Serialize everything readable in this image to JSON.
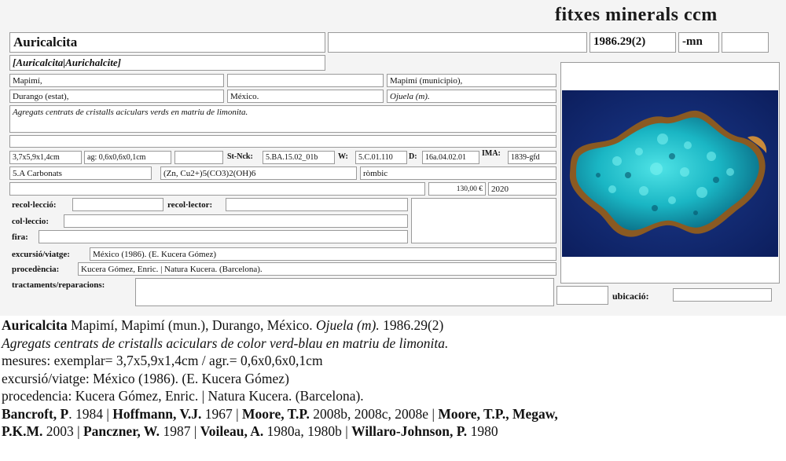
{
  "header": {
    "site_title": "fitxes minerals ccm"
  },
  "card": {
    "mineral_name": "Auricalcita",
    "blank_top_field": "",
    "catalog_number": "1986.29(2)",
    "suffix": "-mn",
    "suffix_extra": "",
    "synonyms": "[Auricalcita|Aurichalcite]",
    "locality": {
      "place": "Mapimí,",
      "place_extra": "",
      "municipality": "Mapimí (municipio),",
      "state": "Durango (estat),",
      "country": "México.",
      "mine": "Ojuela (m)."
    },
    "description": "Agregats centrats de cristalls aciculars verds en matriu de limonita.",
    "blank_line": "",
    "measures": {
      "specimen": "3,7x5,9x1,4cm",
      "aggregate": "ag: 0,6x0,6x0,1cm",
      "extra": ""
    },
    "codes": {
      "strunz_label": "St-Nck:",
      "strunz_value": "5.BA.15.02_01b",
      "w_label": "W:",
      "w_value": "5.C.01.110",
      "d_label": "D:",
      "d_value": "16a.04.02.01",
      "ima_label": "IMA:",
      "ima_value": "1839-gfd"
    },
    "classification": {
      "class": "5.A Carbonats",
      "formula": "(Zn, Cu2+)5(CO3)2(OH)6",
      "crystal_system": "ròmbic"
    },
    "price_row": {
      "note": "",
      "price": "130,00 €",
      "year": "2020"
    },
    "labels": {
      "recollection": "recol·lecció:",
      "collector": "recol·lector:",
      "collection": "col·leccio:",
      "fair": "fira:",
      "trip": "excursió/viatge:",
      "origin": "procedència:",
      "treatments": "tractaments/reparacions:",
      "location": "ubicació:"
    },
    "values": {
      "recollection": "",
      "collector": "",
      "collection": "",
      "fair": "",
      "side_box": "",
      "trip": "México (1986). (E. Kucera Gómez)",
      "origin": "Kucera Gómez, Enric. | Natura Kucera. (Barcelona).",
      "treatments": "",
      "location_pre": "",
      "location": ""
    },
    "photo_icon": "mineral-photo-icon"
  },
  "caption": {
    "line1_name": "Auricalcita",
    "line1_locality": " Mapimí, Mapimí (mun.), Durango, México. ",
    "line1_mine": "Ojuela (m).",
    "line1_number": " 1986.29(2)",
    "line2": "Agregats centrats de cristalls aciculars de color verd-blau en matriu de limonita.",
    "line3": "mesures: exemplar= 3,7x5,9x1,4cm / agr.= 0,6x0,6x0,1cm",
    "line4": "excursió/viatge: México (1986). (E. Kucera Gómez)",
    "line5": "procedencia: Kucera Gómez, Enric. | Natura Kucera. (Barcelona).",
    "refs_line1": [
      {
        "author": "Bancroft, P",
        "rest": ". 1984 | "
      },
      {
        "author": "Hoffmann, V.J.",
        "rest": " 1967 | "
      },
      {
        "author": "Moore, T.P.",
        "rest": " 2008b, 2008c, 2008e | "
      },
      {
        "author": "Moore, T.P., Megaw,",
        "rest": ""
      }
    ],
    "refs_line2": [
      {
        "author": "P.K.M.",
        "rest": " 2003 | "
      },
      {
        "author": "Panczner, W.",
        "rest": " 1987 | "
      },
      {
        "author": "Voileau, A.",
        "rest": " 1980a, 1980b | "
      },
      {
        "author": "Willaro-Johnson, P.",
        "rest": " 1980"
      }
    ]
  }
}
